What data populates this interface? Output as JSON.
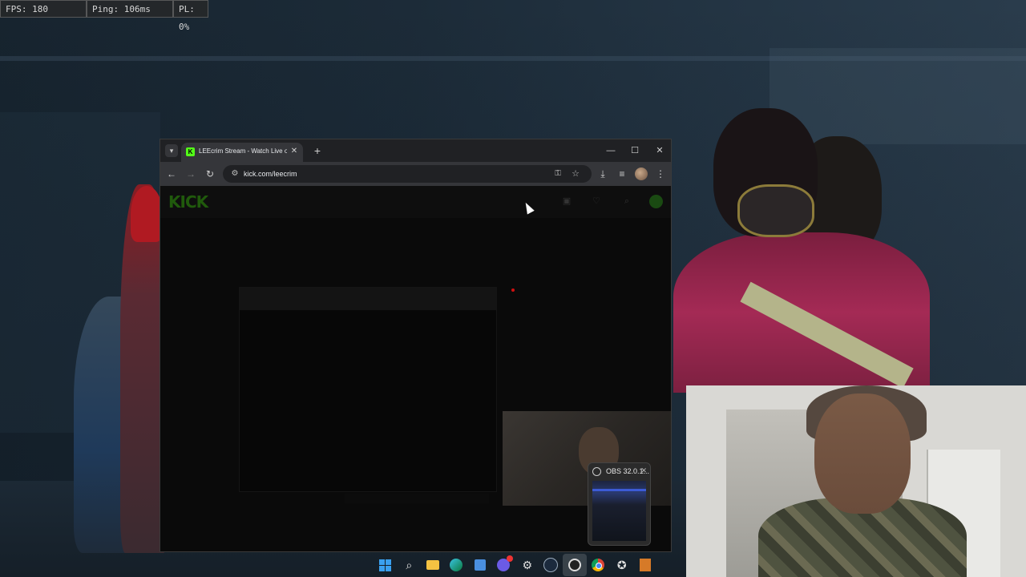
{
  "overlay": {
    "fps": "FPS: 180",
    "ping": "Ping: 106ms",
    "packet_loss": "PL: 0%"
  },
  "browser": {
    "tab_title": "LEEcrim Stream - Watch Live on",
    "url": "kick.com/leecrim",
    "icons": {
      "tab_search": "chevron-down-icon",
      "favicon": "kick-favicon-icon",
      "new_tab": "plus-icon",
      "back": "arrow-left-icon",
      "forward": "arrow-right-icon",
      "reload": "reload-icon",
      "site_info": "tune-icon",
      "password": "key-icon",
      "bookmark": "star-icon",
      "download": "download-icon",
      "media": "media-control-icon",
      "menu": "kebab-menu-icon"
    }
  },
  "kick_page": {
    "logo": "KICK",
    "brand_color": "#53fc18"
  },
  "obs_preview": {
    "title": "OBS 32.0.1..."
  },
  "taskbar": {
    "items": [
      {
        "icon": "windows-start-icon"
      },
      {
        "icon": "search-icon"
      },
      {
        "icon": "file-explorer-icon"
      },
      {
        "icon": "edge-icon"
      },
      {
        "icon": "store-icon"
      },
      {
        "icon": "discord-icon"
      },
      {
        "icon": "settings-app-icon"
      },
      {
        "icon": "steam-icon"
      },
      {
        "icon": "obs-icon",
        "active": true
      },
      {
        "icon": "chrome-icon"
      },
      {
        "icon": "rockstar-icon"
      },
      {
        "icon": "gta-icon"
      }
    ]
  }
}
